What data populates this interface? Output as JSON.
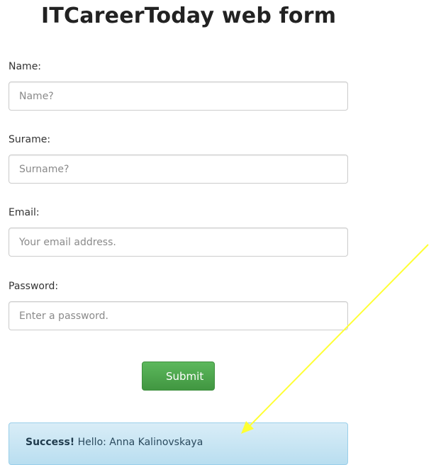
{
  "page": {
    "title": "ITCareerToday web form"
  },
  "form": {
    "fields": [
      {
        "label": "Name:",
        "placeholder": "Name?"
      },
      {
        "label": "Surame:",
        "placeholder": "Surname?"
      },
      {
        "label": "Email:",
        "placeholder": "Your email address."
      },
      {
        "label": "Password:",
        "placeholder": "Enter a password."
      }
    ],
    "submit_label": "Submit"
  },
  "alert": {
    "strong": "Success!",
    "message": "Hello: Anna Kalinovskaya"
  },
  "colors": {
    "submit_button": "#5cb85c",
    "alert_background": "#d9edf7",
    "annotation_arrow": "#ffff33"
  }
}
